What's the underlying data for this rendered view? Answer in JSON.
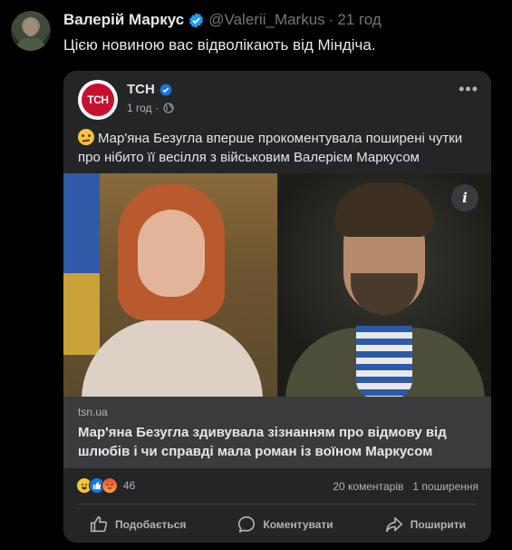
{
  "tweet": {
    "author_name": "Валерій Маркус",
    "handle": "@Valerii_Markus",
    "separator": "·",
    "time": "21 год",
    "text": "Цією новиною вас відволікають від Міндіча."
  },
  "card": {
    "logo_text": "ТСН",
    "page_name": "ТСН",
    "time": "1 год",
    "dot": "·",
    "more": "•••",
    "post_text": "Мар'яна Безугла вперше прокоментувала поширені чутки про нібито її весілля з військовим Валерієм Маркусом",
    "info_label": "i",
    "link": {
      "domain": "tsn.ua",
      "title": "Мар'яна Безугла здивувала зізнанням про відмову від шлюбів і чи справді мала роман із воїном Маркусом"
    },
    "reaction_count": "46",
    "comments": "20 коментарів",
    "shares": "1 поширення",
    "actions": {
      "like": "Подобається",
      "comment": "Коментувати",
      "share": "Поширити"
    }
  },
  "colors": {
    "verified": "#1d9bf0",
    "tsn_red": "#c8102e",
    "card_bg": "#242526",
    "link_bg": "#3a3b3c"
  }
}
